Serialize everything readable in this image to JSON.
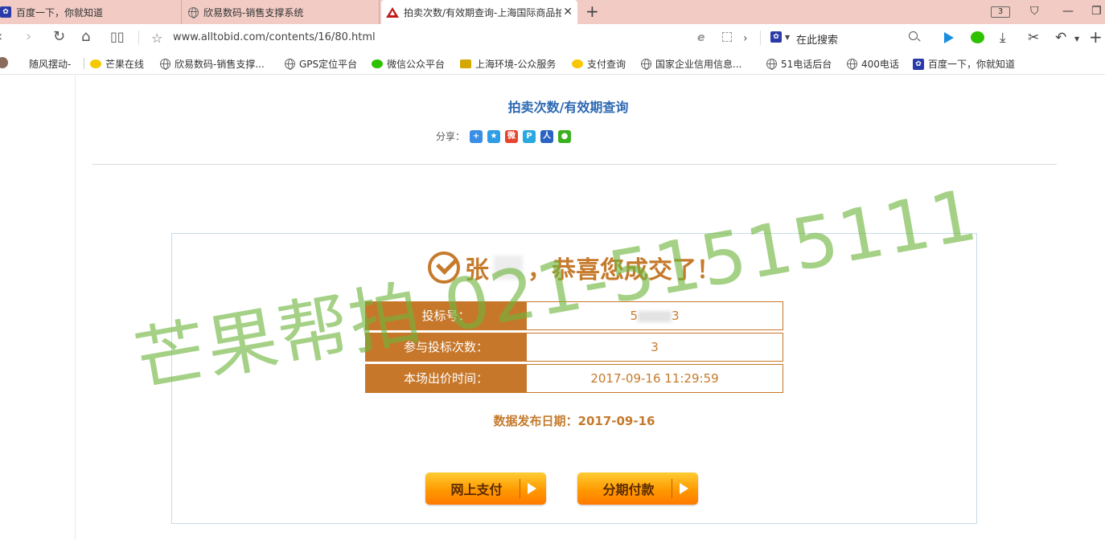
{
  "browser": {
    "tabs": [
      {
        "title": "百度一下，你就知道",
        "icon": "baidu-paw-icon"
      },
      {
        "title": "欣易数码-销售支撑系统",
        "icon": "globe-icon"
      },
      {
        "title": "拍卖次数/有效期查询-上海国际商品拍",
        "icon": "warning-icon",
        "active": true
      }
    ],
    "tab_count": "3",
    "url": "www.alltobid.com/contents/16/80.html",
    "search_placeholder": "在此搜索"
  },
  "bookmarks": [
    {
      "label": "随风摆动-",
      "icon": "avatar"
    },
    {
      "label": "芒果在线",
      "icon": "mango-icon"
    },
    {
      "label": "欣易数码-销售支撑...",
      "icon": "globe-icon"
    },
    {
      "label": "GPS定位平台",
      "icon": "globe-icon"
    },
    {
      "label": "微信公众平台",
      "icon": "wechat-icon"
    },
    {
      "label": "上海环境-公众服务",
      "icon": "recycle-icon"
    },
    {
      "label": "支付查询",
      "icon": "mango-icon"
    },
    {
      "label": "国家企业信用信息...",
      "icon": "globe-icon"
    },
    {
      "label": "51电话后台",
      "icon": "globe-icon"
    },
    {
      "label": "400电话",
      "icon": "globe-icon"
    },
    {
      "label": "百度一下，你就知道",
      "icon": "baidu-paw-icon"
    }
  ],
  "page": {
    "title": "拍卖次数/有效期查询",
    "share_label": "分享：",
    "congrats_name": "张",
    "congrats_text": "，恭喜您成交了！",
    "rows": [
      {
        "label": "投标号：",
        "value_prefix": "5",
        "value_suffix": "3"
      },
      {
        "label": "参与投标次数：",
        "value": "3"
      },
      {
        "label": "本场出价时间：",
        "value": "2017-09-16 11:29:59"
      }
    ],
    "publish_date": "数据发布日期：2017-09-16",
    "buttons": {
      "pay_online": "网上支付",
      "installment": "分期付款"
    },
    "watermark": "芒果帮拍 021-51515111"
  },
  "colors": {
    "accent": "#c7772a",
    "title_blue": "#2d69b2",
    "tab_bar": "#f1cbc4",
    "watermark": "#6eb43c"
  }
}
